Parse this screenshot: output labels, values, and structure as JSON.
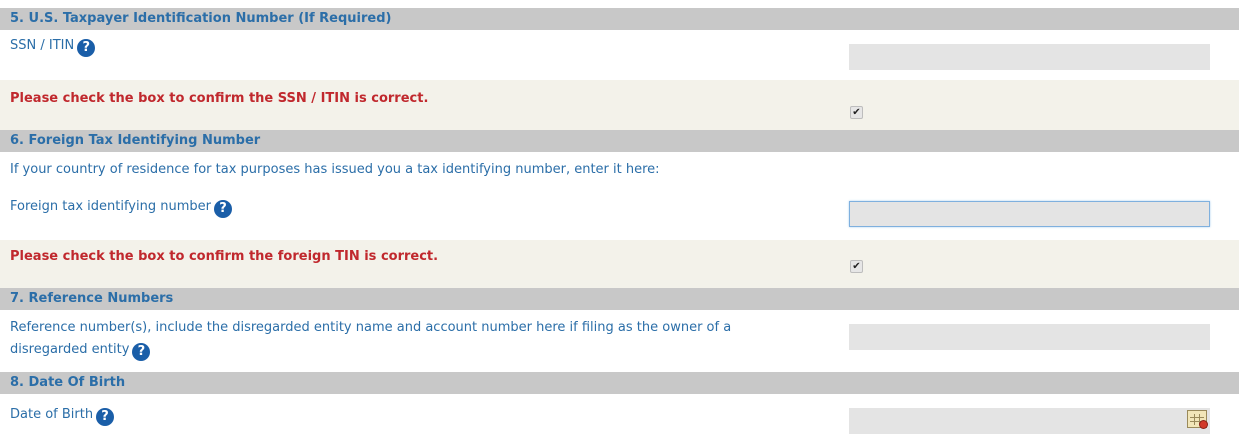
{
  "sections": {
    "tin": {
      "header": "5. U.S. Taxpayer Identification Number (If Required)",
      "ssn_label": "SSN / ITIN",
      "ssn_value": "",
      "confirm_label": "Please check the box to confirm the SSN / ITIN is correct.",
      "confirm_checked": true
    },
    "foreign": {
      "header": "6. Foreign Tax Identifying Number",
      "instruction": "If your country of residence for tax purposes has issued you a tax identifying number, enter it here:",
      "ftin_label": "Foreign tax identifying number",
      "ftin_value": "",
      "confirm_label": "Please check the box to confirm the foreign TIN is correct.",
      "confirm_checked": true
    },
    "reference": {
      "header": "7. Reference Numbers",
      "label_line1": "Reference number(s), include the disregarded entity name and account number here if filing as the owner of a",
      "label_line2": "disregarded entity",
      "value": ""
    },
    "dob": {
      "header": "8. Date Of Birth",
      "label": "Date of Birth",
      "value": ""
    }
  },
  "icons": {
    "help": "question-circle-icon",
    "checkmark": "✔",
    "calendar": "calendar-icon"
  },
  "colors": {
    "header_bg": "#c8c8c8",
    "text": "#2b6ea8",
    "warning": "#c0282d",
    "row_shade": "#f3f2ea",
    "field_bg": "#e4e4e4"
  }
}
